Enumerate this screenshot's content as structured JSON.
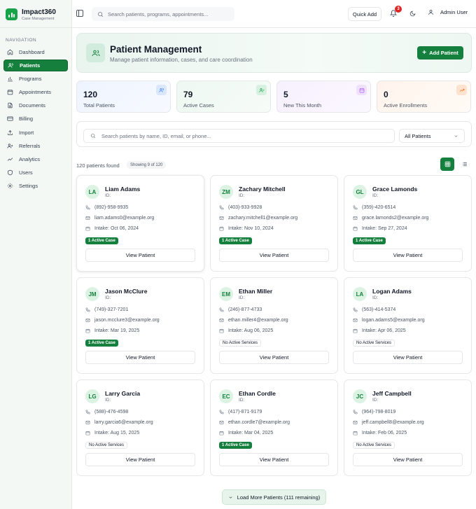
{
  "brand": {
    "title": "Impact360",
    "subtitle": "Case Management"
  },
  "nav": {
    "heading": "NAVIGATION",
    "items": [
      {
        "label": "Dashboard",
        "icon": "home-icon",
        "active": false
      },
      {
        "label": "Patients",
        "icon": "users-icon",
        "active": true
      },
      {
        "label": "Programs",
        "icon": "bar-chart-icon",
        "active": false
      },
      {
        "label": "Appointments",
        "icon": "calendar-icon",
        "active": false
      },
      {
        "label": "Documents",
        "icon": "file-icon",
        "active": false
      },
      {
        "label": "Billing",
        "icon": "credit-card-icon",
        "active": false
      },
      {
        "label": "Import",
        "icon": "upload-icon",
        "active": false
      },
      {
        "label": "Referrals",
        "icon": "user-plus-icon",
        "active": false
      },
      {
        "label": "Analytics",
        "icon": "trend-icon",
        "active": false
      },
      {
        "label": "Users",
        "icon": "shield-icon",
        "active": false
      },
      {
        "label": "Settings",
        "icon": "gear-icon",
        "active": false
      }
    ]
  },
  "topbar": {
    "search_placeholder": "Search patients, programs, appointments...",
    "quick_add": "Quick Add",
    "notifications": "3",
    "user": "Admin User"
  },
  "hero": {
    "title": "Patient Management",
    "subtitle": "Manage patient information, cases, and care coordination",
    "add_button": "Add Patient"
  },
  "stats": [
    {
      "value": "120",
      "label": "Total Patients",
      "color": "#3b82f6"
    },
    {
      "value": "79",
      "label": "Active Cases",
      "color": "#16a34a"
    },
    {
      "value": "5",
      "label": "New This Month",
      "color": "#a855f7"
    },
    {
      "value": "0",
      "label": "Active Enrollments",
      "color": "#f97316"
    }
  ],
  "filters": {
    "search_placeholder": "Search patients by name, ID, email, or phone...",
    "select_value": "All Patients"
  },
  "results": {
    "found": "120 patients found",
    "showing": "Showing 9 of 120"
  },
  "patients": [
    {
      "initials": "LA",
      "name": "Liam Adams",
      "id": "ID:",
      "phone": "(892)-958-9935",
      "email": "liam.adams0@example.org",
      "intake": "Intake: Oct 06, 2024",
      "status": "1 Active Case",
      "active": true
    },
    {
      "initials": "ZM",
      "name": "Zachary Mitchell",
      "id": "ID:",
      "phone": "(403)-933-9928",
      "email": "zachary.mitchell1@example.org",
      "intake": "Intake: Nov 10, 2024",
      "status": "1 Active Case",
      "active": true
    },
    {
      "initials": "GL",
      "name": "Grace Lamonds",
      "id": "ID:",
      "phone": "(359)-420-6514",
      "email": "grace.lamonds2@example.org",
      "intake": "Intake: Sep 27, 2024",
      "status": "1 Active Case",
      "active": true
    },
    {
      "initials": "JM",
      "name": "Jason McClure",
      "id": "ID:",
      "phone": "(749)-327-7201",
      "email": "jason.mcclure3@example.org",
      "intake": "Intake: Mar 19, 2025",
      "status": "1 Active Case",
      "active": true
    },
    {
      "initials": "EM",
      "name": "Ethan Miller",
      "id": "ID:",
      "phone": "(246)-877-4733",
      "email": "ethan.miller4@example.org",
      "intake": "Intake: Aug 06, 2025",
      "status": "No Active Services",
      "active": false
    },
    {
      "initials": "LA",
      "name": "Logan Adams",
      "id": "ID:",
      "phone": "(563)-414-5374",
      "email": "logan.adams5@example.org",
      "intake": "Intake: Apr 06, 2025",
      "status": "No Active Services",
      "active": false
    },
    {
      "initials": "LG",
      "name": "Larry Garcia",
      "id": "ID:",
      "phone": "(588)-476-4598",
      "email": "larry.garcia6@example.org",
      "intake": "Intake: Aug 15, 2025",
      "status": "No Active Services",
      "active": false
    },
    {
      "initials": "EC",
      "name": "Ethan Cordle",
      "id": "ID:",
      "phone": "(417)-871-9179",
      "email": "ethan.cordle7@example.org",
      "intake": "Intake: Mar 04, 2025",
      "status": "1 Active Case",
      "active": true
    },
    {
      "initials": "JC",
      "name": "Jeff Campbell",
      "id": "ID:",
      "phone": "(964)-798-8019",
      "email": "jeff.campbell8@example.org",
      "intake": "Intake: Feb 06, 2025",
      "status": "No Active Services",
      "active": false
    }
  ],
  "card_button": "View Patient",
  "load_more": "Load More Patients (111 remaining)"
}
